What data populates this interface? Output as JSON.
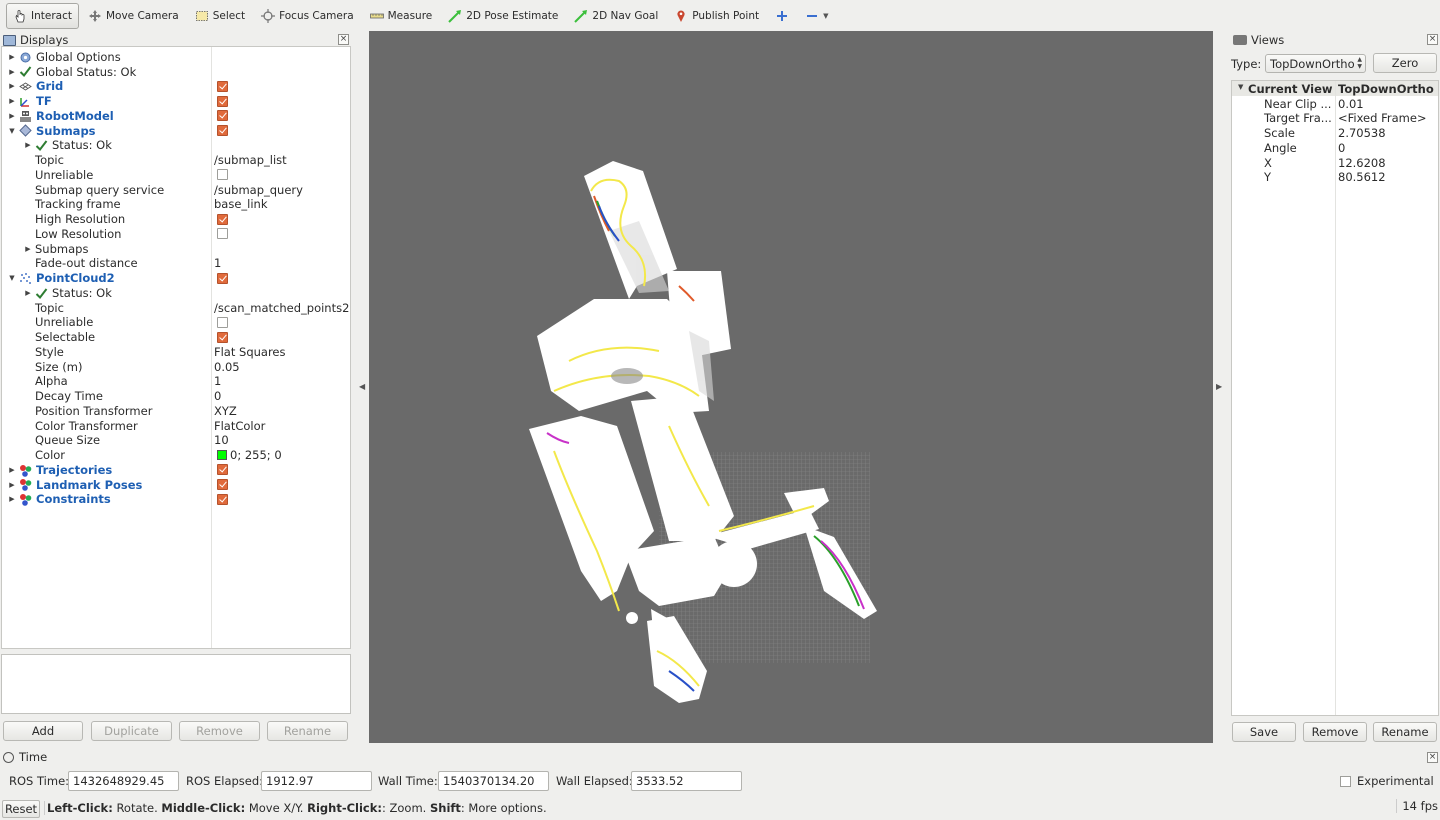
{
  "toolbar": {
    "interact": "Interact",
    "move_camera": "Move Camera",
    "select": "Select",
    "focus_camera": "Focus Camera",
    "measure": "Measure",
    "pose_estimate": "2D Pose Estimate",
    "nav_goal": "2D Nav Goal",
    "publish_point": "Publish Point"
  },
  "displays": {
    "title": "Displays",
    "rows": [
      {
        "label": "Global Options"
      },
      {
        "label": "Global Status: Ok"
      },
      {
        "label": "Grid"
      },
      {
        "label": "TF"
      },
      {
        "label": "RobotModel"
      },
      {
        "label": "Submaps"
      },
      {
        "label": "Status: Ok"
      },
      {
        "label": "Topic",
        "value": "/submap_list"
      },
      {
        "label": "Unreliable"
      },
      {
        "label": "Submap query service",
        "value": "/submap_query"
      },
      {
        "label": "Tracking frame",
        "value": "base_link"
      },
      {
        "label": "High Resolution"
      },
      {
        "label": "Low Resolution"
      },
      {
        "label": "Submaps"
      },
      {
        "label": "Fade-out distance",
        "value": "1"
      },
      {
        "label": "PointCloud2"
      },
      {
        "label": "Status: Ok"
      },
      {
        "label": "Topic",
        "value": "/scan_matched_points2"
      },
      {
        "label": "Unreliable"
      },
      {
        "label": "Selectable"
      },
      {
        "label": "Style",
        "value": "Flat Squares"
      },
      {
        "label": "Size (m)",
        "value": "0.05"
      },
      {
        "label": "Alpha",
        "value": "1"
      },
      {
        "label": "Decay Time",
        "value": "0"
      },
      {
        "label": "Position Transformer",
        "value": "XYZ"
      },
      {
        "label": "Color Transformer",
        "value": "FlatColor"
      },
      {
        "label": "Queue Size",
        "value": "10"
      },
      {
        "label": "Color",
        "value": "0; 255; 0"
      },
      {
        "label": "Trajectories"
      },
      {
        "label": "Landmark Poses"
      },
      {
        "label": "Constraints"
      }
    ],
    "buttons": {
      "add": "Add",
      "duplicate": "Duplicate",
      "remove": "Remove",
      "rename": "Rename"
    }
  },
  "views": {
    "title": "Views",
    "type_label": "Type:",
    "type_value": "TopDownOrtho",
    "zero": "Zero",
    "header_name": "Current View",
    "header_value": "TopDownOrtho ...",
    "props": [
      {
        "label": "Near Clip ...",
        "value": "0.01"
      },
      {
        "label": "Target Fra...",
        "value": "<Fixed Frame>"
      },
      {
        "label": "Scale",
        "value": "2.70538"
      },
      {
        "label": "Angle",
        "value": "0"
      },
      {
        "label": "X",
        "value": "12.6208"
      },
      {
        "label": "Y",
        "value": "80.5612"
      }
    ],
    "buttons": {
      "save": "Save",
      "remove": "Remove",
      "rename": "Rename"
    }
  },
  "time": {
    "title": "Time",
    "ros_time_label": "ROS Time:",
    "ros_time": "1432648929.45",
    "ros_elapsed_label": "ROS Elapsed:",
    "ros_elapsed": "1912.97",
    "wall_time_label": "Wall Time:",
    "wall_time": "1540370134.20",
    "wall_elapsed_label": "Wall Elapsed:",
    "wall_elapsed": "3533.52",
    "experimental": "Experimental"
  },
  "status": {
    "reset": "Reset",
    "left_click": "Left-Click:",
    "left_click_desc": " Rotate. ",
    "middle_click": "Middle-Click:",
    "middle_click_desc": " Move X/Y. ",
    "right_click": "Right-Click:",
    "right_click_desc": ": Zoom. ",
    "shift": "Shift",
    "shift_desc": ": More options.",
    "fps": "14 fps"
  },
  "colors": {
    "accent_blue": "#1e5fb3",
    "checkbox_orange": "#e06a3b",
    "viewport_bg": "#6a6a6a",
    "color_swatch": "#00ff00"
  }
}
